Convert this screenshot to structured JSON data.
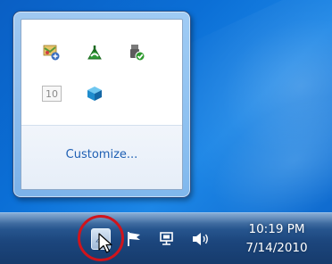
{
  "overflow_panel": {
    "icons": [
      {
        "name": "network-map-icon"
      },
      {
        "name": "green-recycle-icon"
      },
      {
        "name": "usb-safely-remove-icon"
      },
      {
        "name": "ime-10-icon",
        "text": "10"
      },
      {
        "name": "blue-cube-icon"
      }
    ],
    "customize_label": "Customize..."
  },
  "taskbar": {
    "show_hidden_icons_button": "show-hidden-icons",
    "tray_icons": [
      "action-center-flag-icon",
      "network-icon",
      "volume-icon"
    ],
    "clock": {
      "time": "10:19 PM",
      "date": "7/14/2010"
    }
  },
  "colors": {
    "desktop": "#0b6fd6",
    "taskbar": "#1c467d",
    "link": "#1e5fb3",
    "highlight": "#d0141c"
  }
}
